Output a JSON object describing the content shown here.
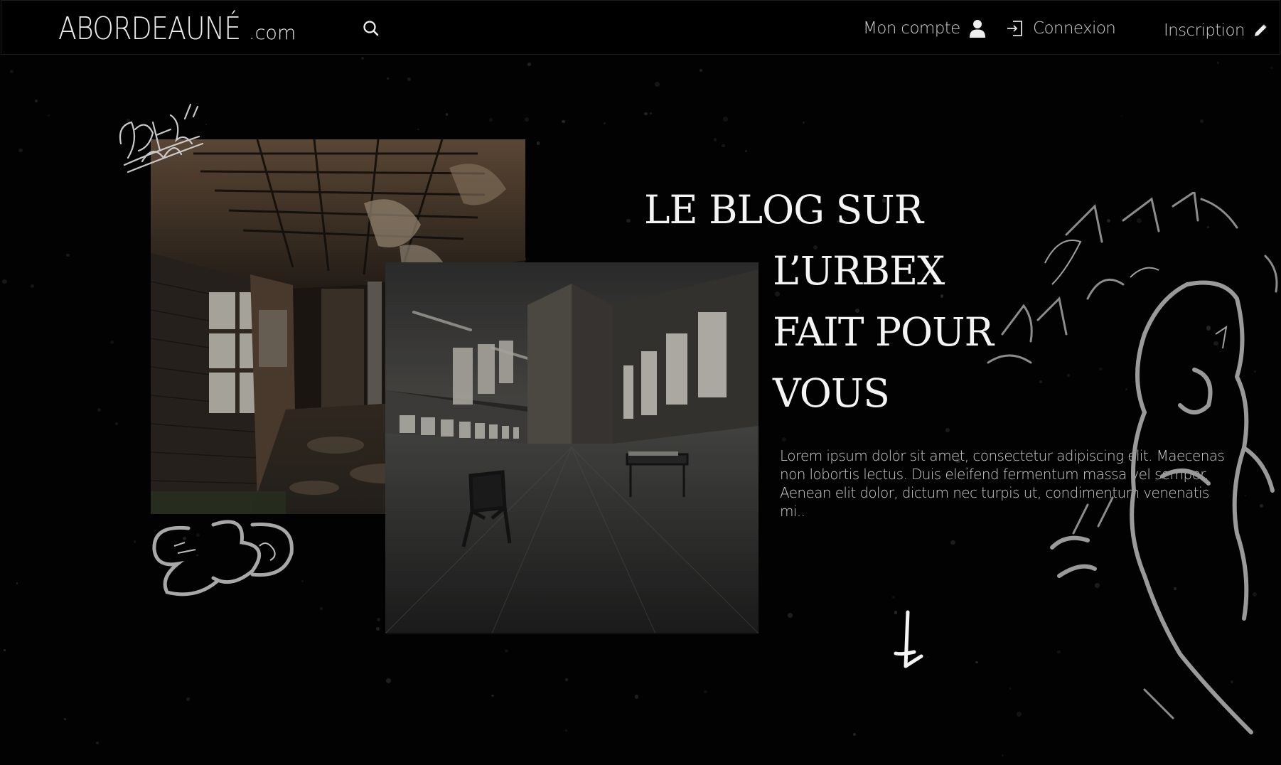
{
  "header": {
    "logo_main": "ABORDEAUNÉ",
    "logo_tld": ".com",
    "nav": {
      "account_label": "Mon compte",
      "login_label": "Connexion",
      "signup_label": "Inscription"
    },
    "icons": {
      "search": "search-icon",
      "account": "user-icon",
      "login": "login-icon",
      "signup": "pencil-icon"
    }
  },
  "hero": {
    "title_lines": [
      "LE BLOG SUR",
      "L’URBEX",
      "FAIT POUR",
      "VOUS"
    ],
    "lede": "Lorem ipsum dolor sit amet, consectetur adipiscing elit. Maecenas non lobortis lectus. Duis eleifend fermentum massa vel semper. Aenean elit dolor, dictum nec turpis ut, condimentum venenatis mi..",
    "scroll_icon": "arrow-down-icon"
  },
  "colors": {
    "background": "#020202",
    "text": "#f4f4f4",
    "muted_text": "#cfcfcf",
    "graffiti": "#9a9a9a"
  }
}
